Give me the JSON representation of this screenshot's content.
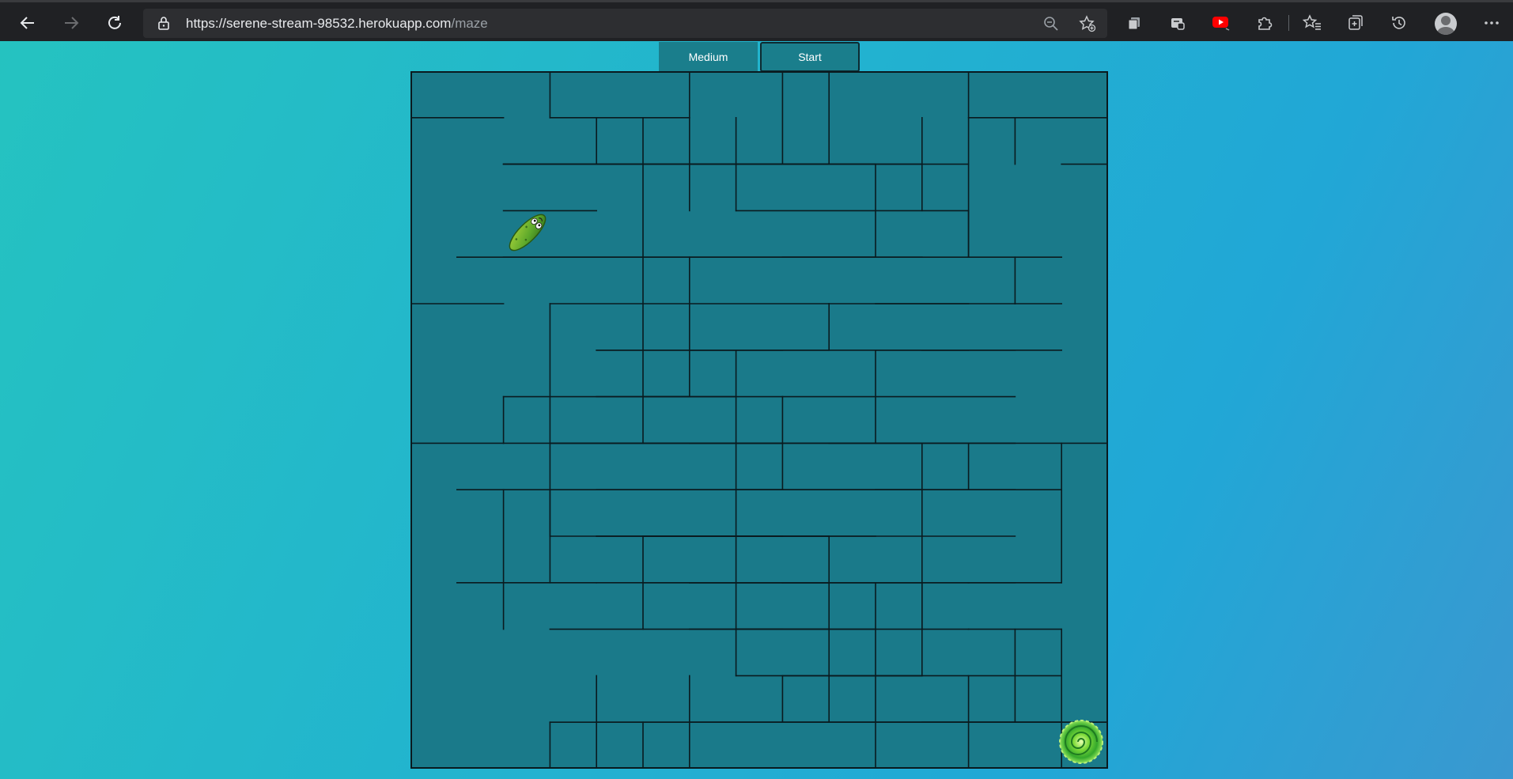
{
  "browser": {
    "url_host": "https://serene-stream-98532.herokuapp.com",
    "url_path": "/maze",
    "icons": [
      "back-arrow-icon",
      "forward-arrow-icon",
      "refresh-icon",
      "lock-icon",
      "zoom-out-icon",
      "add-favorite-icon",
      "collections-icon",
      "extension-icon",
      "youtube-icon",
      "puzzle-extensions-icon",
      "favorites-icon",
      "collections-add-icon",
      "history-icon",
      "profile-icon",
      "more-icon"
    ]
  },
  "controls": {
    "difficulty_label": "Medium",
    "start_label": "Start"
  },
  "maze": {
    "rows": 15,
    "cols": 15,
    "wall_color": "#0a1a1f",
    "cell_color": "#1a7a8a",
    "player_cell": [
      3,
      2
    ],
    "goal_cell": [
      14,
      14
    ],
    "player_icon": "pickle-icon",
    "goal_icon": "portal-icon",
    "walls_h": [
      [
        0,
        0,
        1
      ],
      [
        4,
        0,
        1
      ],
      [
        7,
        0,
        1
      ],
      [
        8,
        1,
        2
      ],
      [
        10,
        1,
        3
      ],
      [
        2,
        2,
        3
      ],
      [
        3,
        2,
        4
      ],
      [
        6,
        2,
        7
      ],
      [
        1,
        3,
        2
      ],
      [
        7,
        3,
        7
      ],
      [
        9,
        3,
        8
      ],
      [
        11,
        3,
        8
      ],
      [
        13,
        3,
        13
      ],
      [
        14,
        3,
        13
      ],
      [
        0,
        4,
        3
      ],
      [
        6,
        4,
        5
      ],
      [
        9,
        4,
        7
      ],
      [
        10,
        4,
        8
      ],
      [
        13,
        4,
        8
      ],
      [
        0,
        5,
        5
      ],
      [
        9,
        5,
        6
      ],
      [
        6,
        6,
        5
      ],
      [
        7,
        6,
        7
      ],
      [
        13,
        6,
        7
      ],
      [
        5,
        7,
        4
      ],
      [
        7,
        7,
        2
      ],
      [
        8,
        7,
        3
      ],
      [
        9,
        7,
        4
      ],
      [
        10,
        7,
        5
      ],
      [
        11,
        7,
        6
      ],
      [
        12,
        7,
        7
      ],
      [
        1,
        8,
        2
      ],
      [
        4,
        8,
        3
      ],
      [
        5,
        8,
        4
      ],
      [
        9,
        8,
        5
      ],
      [
        10,
        8,
        6
      ],
      [
        11,
        8,
        7
      ],
      [
        12,
        8,
        8
      ],
      [
        13,
        8,
        9
      ],
      [
        1,
        9,
        4
      ],
      [
        3,
        9,
        1
      ],
      [
        7,
        9,
        6
      ],
      [
        9,
        9,
        7
      ],
      [
        10,
        9,
        8
      ],
      [
        11,
        9,
        9
      ],
      [
        12,
        9,
        10
      ],
      [
        13,
        9,
        11
      ],
      [
        14,
        9,
        12
      ],
      [
        1,
        10,
        2
      ],
      [
        3,
        10,
        5
      ],
      [
        7,
        10,
        3
      ],
      [
        8,
        10,
        4
      ],
      [
        9,
        10,
        5
      ],
      [
        10,
        10,
        6
      ],
      [
        11,
        10,
        7
      ],
      [
        12,
        10,
        8
      ],
      [
        14,
        10,
        9
      ],
      [
        1,
        11,
        6
      ],
      [
        2,
        11,
        7
      ],
      [
        3,
        11,
        8
      ],
      [
        4,
        11,
        10
      ],
      [
        5,
        11,
        11
      ],
      [
        10,
        11,
        10
      ],
      [
        11,
        11,
        11
      ],
      [
        13,
        11,
        12
      ],
      [
        14,
        11,
        13
      ],
      [
        0,
        12,
        14
      ],
      [
        3,
        12,
        13
      ],
      [
        4,
        12,
        9
      ],
      [
        5,
        12,
        10
      ],
      [
        6,
        12,
        8
      ],
      [
        7,
        12,
        9
      ],
      [
        8,
        12,
        10
      ],
      [
        9,
        12,
        11
      ],
      [
        10,
        12,
        12
      ],
      [
        11,
        12,
        13
      ],
      [
        4,
        13,
        13
      ],
      [
        5,
        13,
        6
      ],
      [
        8,
        13,
        7
      ],
      [
        10,
        13,
        8
      ],
      [
        12,
        13,
        9
      ],
      [
        13,
        13,
        10
      ],
      [
        14,
        13,
        11
      ],
      [
        13,
        14,
        13
      ],
      [
        1,
        14,
        14
      ],
      [
        7,
        14,
        10
      ],
      [
        13,
        14,
        12
      ]
    ],
    "walls_v": [
      [
        2,
        0,
        0
      ],
      [
        5,
        0,
        0
      ],
      [
        8,
        0,
        1
      ],
      [
        11,
        0,
        3
      ],
      [
        14,
        0,
        2
      ],
      [
        4,
        1,
        7
      ],
      [
        5,
        1,
        2
      ],
      [
        6,
        1,
        2
      ],
      [
        7,
        1,
        0
      ],
      [
        3,
        1,
        1
      ],
      [
        12,
        1,
        1
      ],
      [
        10,
        2,
        1
      ],
      [
        9,
        2,
        3
      ],
      [
        11,
        3,
        3
      ],
      [
        12,
        4,
        4
      ],
      [
        5,
        4,
        6
      ],
      [
        2,
        5,
        9
      ],
      [
        8,
        5,
        5
      ],
      [
        6,
        6,
        9
      ],
      [
        9,
        6,
        7
      ],
      [
        7,
        7,
        8
      ],
      [
        1,
        7,
        7
      ],
      [
        11,
        8,
        8
      ],
      [
        10,
        8,
        11
      ],
      [
        13,
        8,
        10
      ],
      [
        1,
        9,
        11
      ],
      [
        2,
        9,
        10
      ],
      [
        4,
        10,
        11
      ],
      [
        6,
        10,
        12
      ],
      [
        8,
        10,
        13
      ],
      [
        9,
        11,
        13
      ],
      [
        10,
        11,
        12
      ],
      [
        12,
        12,
        13
      ],
      [
        13,
        12,
        13
      ],
      [
        14,
        12,
        12
      ],
      [
        5,
        13,
        14
      ],
      [
        3,
        13,
        14
      ],
      [
        4,
        14,
        14
      ],
      [
        7,
        13,
        13
      ],
      [
        9,
        14,
        14
      ],
      [
        11,
        14,
        13
      ],
      [
        13,
        14,
        14
      ],
      [
        2,
        14,
        14
      ]
    ]
  }
}
